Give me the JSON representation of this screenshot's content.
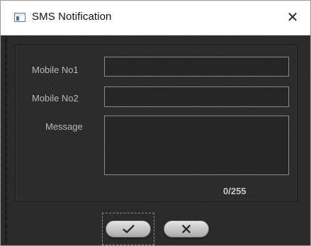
{
  "window": {
    "title": "SMS Notification",
    "icon": "app-window-icon",
    "close_symbol": "✕"
  },
  "form": {
    "mobile1": {
      "label": "Mobile No1",
      "value": "",
      "placeholder": ""
    },
    "mobile2": {
      "label": "Mobile No2",
      "value": "",
      "placeholder": ""
    },
    "message": {
      "label": "Message",
      "value": "",
      "placeholder": ""
    },
    "char_count": "0/255"
  },
  "buttons": {
    "ok_icon": "check-icon",
    "cancel_icon": "x-icon"
  },
  "colors": {
    "background": "#2b2b2b",
    "label_text": "#b8b8b8",
    "field_border": "#8a8a8a",
    "button_face": "#c4c4c4"
  }
}
